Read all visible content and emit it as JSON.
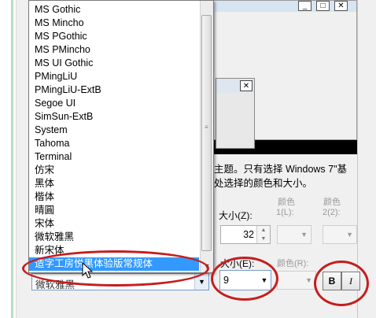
{
  "font_list": {
    "items": [
      "MS Gothic",
      "MS Mincho",
      "MS PGothic",
      "MS PMincho",
      "MS UI Gothic",
      "PMingLiU",
      "PMingLiU-ExtB",
      "Segoe UI",
      "SimSun-ExtB",
      "System",
      "Tahoma",
      "Terminal",
      "仿宋",
      "黑体",
      "楷体",
      "晴圓",
      "宋体",
      "微软雅黑",
      "新宋体",
      "造字工房悦黑体验版常规体"
    ],
    "selected": "造字工房悦黑体验版常规体",
    "combo_value": "微软雅黑"
  },
  "preview": {
    "minimize_glyph": "_",
    "maximize_glyph": "□",
    "close_glyph": "✕",
    "inner_close_glyph": "✕"
  },
  "description": {
    "line1": "主题。只有选择 Windows 7\"基",
    "line2": "处选择的颜色和大小。"
  },
  "labels": {
    "color1_header": "颜色",
    "color1_sub": "1(L):",
    "color2_header": "颜色",
    "color2_sub": "2(2):",
    "size_label": "大小(Z):",
    "font_size_label": "大小(E):",
    "font_color_label": "颜色(R):"
  },
  "values": {
    "item_size": "32",
    "font_size": "9"
  },
  "format_buttons": {
    "bold": "B",
    "italic": "I"
  },
  "annotation_color": "#c41e1e"
}
